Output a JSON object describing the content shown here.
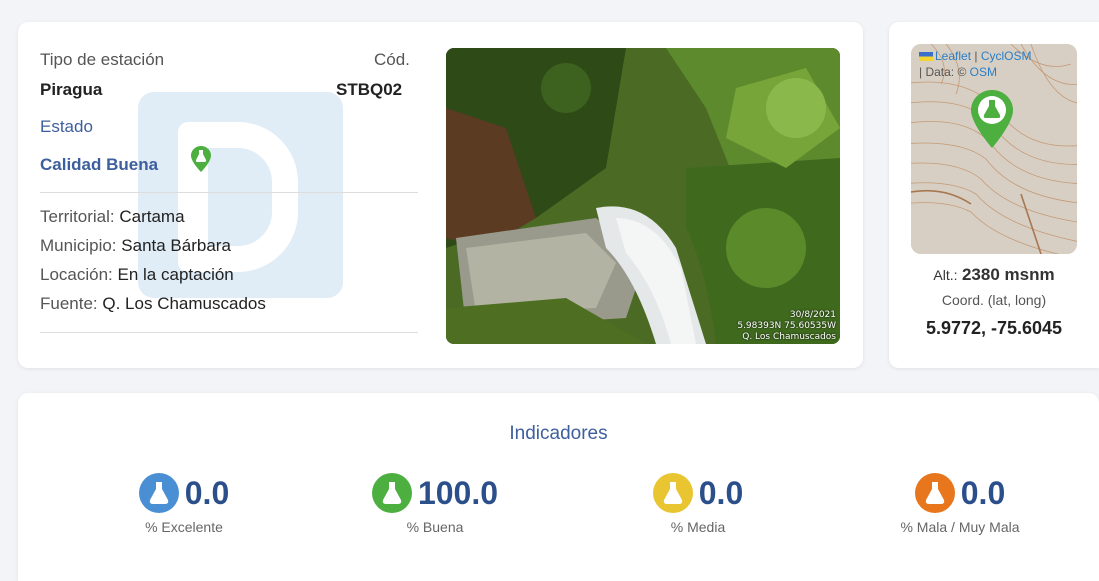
{
  "station": {
    "type_label": "Tipo de estación",
    "type_value": "Piragua",
    "code_label": "Cód.",
    "code_value": "STBQ02",
    "status_label": "Estado",
    "status_value": "Calidad Buena",
    "territorial_label": "Territorial:",
    "territorial_value": "Cartama",
    "municipio_label": "Municipio:",
    "municipio_value": "Santa Bárbara",
    "locacion_label": "Locación:",
    "locacion_value": "En la captación",
    "fuente_label": "Fuente:",
    "fuente_value": "Q. Los Chamuscados"
  },
  "photo": {
    "date": "30/8/2021",
    "coords": "5.98393N 75.60535W",
    "source": "Q. Los Chamuscados"
  },
  "map": {
    "leaflet": "Leaflet",
    "separator": "|",
    "cyclosm": "CyclOSM",
    "data_prefix": "| Data: ©",
    "osm": "OSM",
    "alt_label": "Alt.:",
    "alt_value": "2380 msnm",
    "coord_label": "Coord. (lat, long)",
    "coord_value": "5.9772, -75.6045"
  },
  "indicators": {
    "title": "Indicadores",
    "items": [
      {
        "value": "0.0",
        "label": "% Excelente",
        "color": "#4a8fd4"
      },
      {
        "value": "100.0",
        "label": "% Buena",
        "color": "#4caf3f"
      },
      {
        "value": "0.0",
        "label": "% Media",
        "color": "#e9c531"
      },
      {
        "value": "0.0",
        "label": "% Mala / Muy Mala",
        "color": "#e8761c"
      }
    ]
  },
  "colors": {
    "accent_blue": "#3e5f9d",
    "good_green": "#4caf3f"
  }
}
